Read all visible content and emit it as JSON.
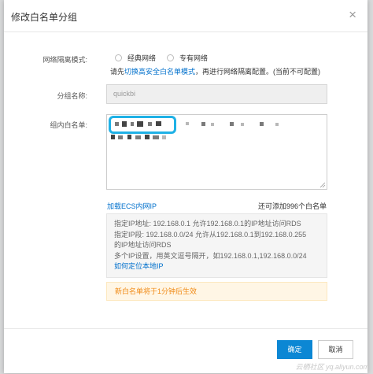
{
  "dialog": {
    "title": "修改白名单分组",
    "close_glyph": "×"
  },
  "form": {
    "mode_label": "网络隔离模式:",
    "mode_options": [
      {
        "label": "经典网络",
        "selected": false
      },
      {
        "label": "专有网络",
        "selected": false
      }
    ],
    "tip_prefix": "请先",
    "tip_link": "切换高安全白名单模式",
    "tip_suffix": "，再进行网络隔离配置。(当前不可配置)",
    "group_label": "分组名称:",
    "group_value": "quickbi",
    "whitelist_label": "组内白名单:",
    "ecs_link": "加载ECS内网IP",
    "remaining": "还可添加996个白名单"
  },
  "help": {
    "lines": [
      "指定IP地址: 192.168.0.1 允许192.168.0.1的IP地址访问RDS",
      "指定IP段: 192.168.0.0/24 允许从192.168.0.1到192.168.0.255",
      "的IP地址访问RDS",
      "多个IP设置，用英文逗号隔开，如192.168.0.1,192.168.0.0/24"
    ],
    "link": "如何定位本地IP"
  },
  "notice": "新白名单将于1分钟后生效",
  "buttons": {
    "ok": "确定",
    "cancel": "取消"
  },
  "watermark": "云栖社区 yq.aliyun.com",
  "colors": {
    "primary": "#0c87d4",
    "link": "#0070cc",
    "notice_text": "#f08a15",
    "notice_bg": "#fff6e5",
    "highlight": "#1fb1e6"
  }
}
